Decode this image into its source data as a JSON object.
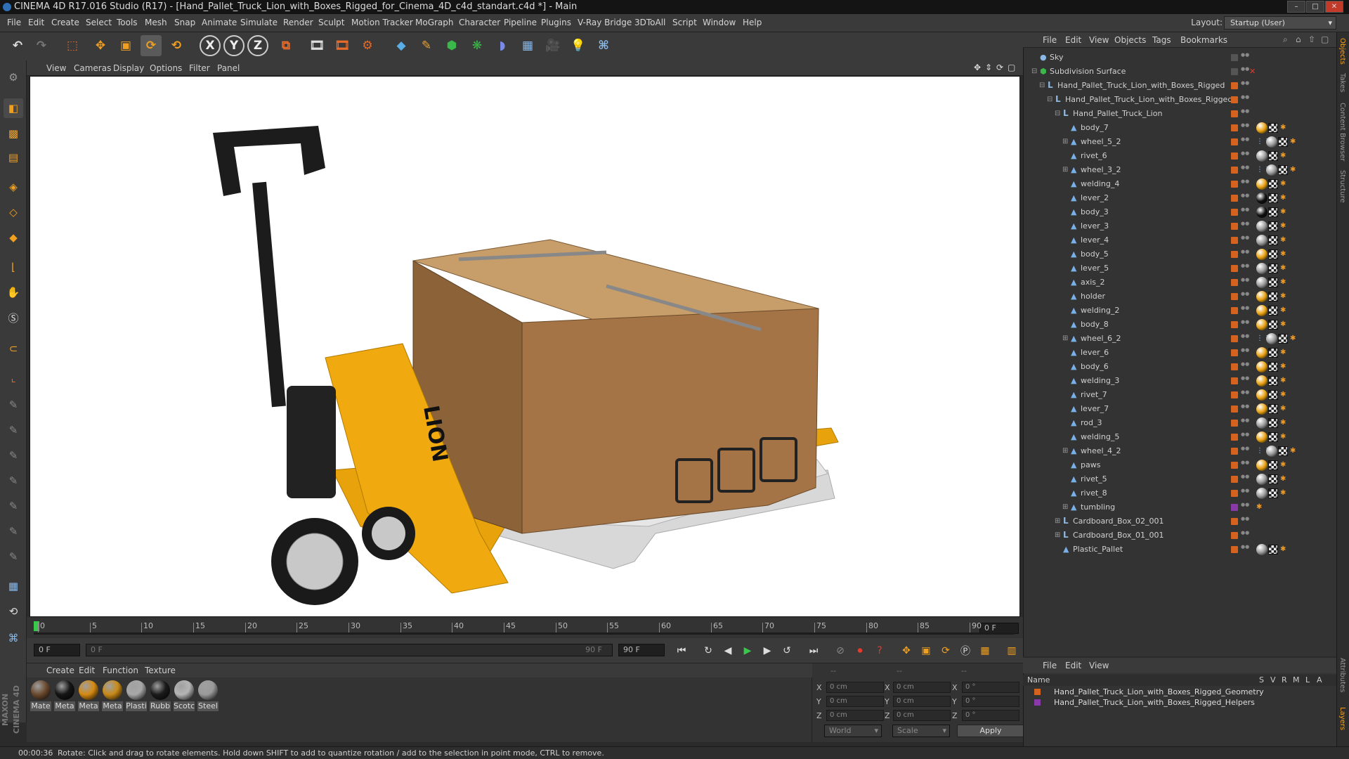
{
  "window": {
    "title": "CINEMA 4D R17.016 Studio (R17) - [Hand_Pallet_Truck_Lion_with_Boxes_Rigged_for_Cinema_4D_c4d_standart.c4d *] - Main"
  },
  "menubar": {
    "items": [
      "File",
      "Edit",
      "Create",
      "Select",
      "Tools",
      "Mesh",
      "Snap",
      "Animate",
      "Simulate",
      "Render",
      "Sculpt",
      "Motion Tracker",
      "MoGraph",
      "Character",
      "Pipeline",
      "Plugins",
      "V-Ray Bridge",
      "3DToAll",
      "Script",
      "Window",
      "Help"
    ],
    "layout_label": "Layout:",
    "layout_value": "Startup (User)"
  },
  "viewport_menu": [
    "View",
    "Cameras",
    "Display",
    "Options",
    "Filter",
    "Panel"
  ],
  "timeline": {
    "ticks": [
      "0",
      "5",
      "10",
      "15",
      "20",
      "25",
      "30",
      "35",
      "40",
      "45",
      "50",
      "55",
      "60",
      "65",
      "70",
      "75",
      "80",
      "85",
      "90"
    ],
    "current_frame_right": "0 F",
    "frame_start": "0 F",
    "frame_field": "0 F",
    "frame_end_inner": "90 F",
    "frame_end": "90 F"
  },
  "material_menu": [
    "Create",
    "Edit",
    "Function",
    "Texture"
  ],
  "materials": [
    {
      "label": "Mate",
      "color": "#6b4a2f"
    },
    {
      "label": "Meta",
      "color": "#151515"
    },
    {
      "label": "Meta",
      "color": "#d58a12"
    },
    {
      "label": "Meta",
      "color": "#c98a18"
    },
    {
      "label": "Plasti",
      "color": "#a8a8a8"
    },
    {
      "label": "Rubb",
      "color": "#1b1b1b"
    },
    {
      "label": "Scotc",
      "color": "#b5b5b5"
    },
    {
      "label": "Steel",
      "color": "#9a9a9a"
    }
  ],
  "coords": {
    "header_dashes": [
      "--",
      "--",
      "--"
    ],
    "rows": [
      {
        "a": "X",
        "av": "0 cm",
        "b": "X",
        "bv": "0 cm",
        "c": "X",
        "cv": "0 °"
      },
      {
        "a": "Y",
        "av": "0 cm",
        "b": "Y",
        "bv": "0 cm",
        "c": "Y",
        "cv": "0 °"
      },
      {
        "a": "Z",
        "av": "0 cm",
        "b": "Z",
        "bv": "0 cm",
        "c": "Z",
        "cv": "0 °"
      }
    ],
    "space": "World",
    "mode": "Scale",
    "apply": "Apply"
  },
  "object_manager": {
    "menu": [
      "File",
      "Edit",
      "View",
      "Objects",
      "Tags",
      "Bookmarks"
    ],
    "objects": [
      {
        "name": "Sky",
        "depth": 0,
        "tree": "",
        "type": "sky",
        "tags": []
      },
      {
        "name": "Subdivision Surface",
        "depth": 0,
        "tree": "⊟",
        "type": "subdiv",
        "tags": []
      },
      {
        "name": "Hand_Pallet_Truck_Lion_with_Boxes_Rigged",
        "depth": 1,
        "tree": "⊟",
        "type": "null",
        "tags": []
      },
      {
        "name": "Hand_Pallet_Truck_Lion_with_Boxes_Rigged",
        "depth": 2,
        "tree": "⊟",
        "type": "null",
        "tags": []
      },
      {
        "name": "Hand_Pallet_Truck_Lion",
        "depth": 3,
        "tree": "⊟",
        "type": "null",
        "tags": []
      },
      {
        "name": "body_7",
        "depth": 4,
        "tree": "",
        "type": "poly",
        "tags": [
          "ball-orange",
          "chk",
          "or"
        ]
      },
      {
        "name": "wheel_5_2",
        "depth": 4,
        "tree": "⊞",
        "type": "poly",
        "tags": [
          "dots",
          "ball-grey",
          "chk",
          "or"
        ]
      },
      {
        "name": "rivet_6",
        "depth": 4,
        "tree": "",
        "type": "poly",
        "tags": [
          "ball-grey",
          "chk",
          "or"
        ]
      },
      {
        "name": "wheel_3_2",
        "depth": 4,
        "tree": "⊞",
        "type": "poly",
        "tags": [
          "dots",
          "ball-grey",
          "chk",
          "or"
        ]
      },
      {
        "name": "welding_4",
        "depth": 4,
        "tree": "",
        "type": "poly",
        "tags": [
          "ball-orange",
          "chk",
          "or"
        ]
      },
      {
        "name": "lever_2",
        "depth": 4,
        "tree": "",
        "type": "poly",
        "tags": [
          "ball-black",
          "chk",
          "or"
        ]
      },
      {
        "name": "body_3",
        "depth": 4,
        "tree": "",
        "type": "poly",
        "tags": [
          "ball-black",
          "chk",
          "or"
        ]
      },
      {
        "name": "lever_3",
        "depth": 4,
        "tree": "",
        "type": "poly",
        "tags": [
          "ball-grey",
          "chk",
          "or"
        ]
      },
      {
        "name": "lever_4",
        "depth": 4,
        "tree": "",
        "type": "poly",
        "tags": [
          "ball-grey",
          "chk",
          "or"
        ]
      },
      {
        "name": "body_5",
        "depth": 4,
        "tree": "",
        "type": "poly",
        "tags": [
          "ball-orange",
          "chk",
          "or"
        ]
      },
      {
        "name": "lever_5",
        "depth": 4,
        "tree": "",
        "type": "poly",
        "tags": [
          "ball-grey",
          "chk",
          "or"
        ]
      },
      {
        "name": "axis_2",
        "depth": 4,
        "tree": "",
        "type": "poly",
        "tags": [
          "ball-grey",
          "chk",
          "or"
        ]
      },
      {
        "name": "holder",
        "depth": 4,
        "tree": "",
        "type": "poly",
        "tags": [
          "ball-orange",
          "chk",
          "or"
        ]
      },
      {
        "name": "welding_2",
        "depth": 4,
        "tree": "",
        "type": "poly",
        "tags": [
          "ball-orange",
          "chk",
          "or"
        ]
      },
      {
        "name": "body_8",
        "depth": 4,
        "tree": "",
        "type": "poly",
        "tags": [
          "ball-orange",
          "chk",
          "or"
        ]
      },
      {
        "name": "wheel_6_2",
        "depth": 4,
        "tree": "⊞",
        "type": "poly",
        "tags": [
          "dots",
          "ball-grey",
          "chk",
          "or"
        ]
      },
      {
        "name": "lever_6",
        "depth": 4,
        "tree": "",
        "type": "poly",
        "tags": [
          "ball-orange",
          "chk",
          "or"
        ]
      },
      {
        "name": "body_6",
        "depth": 4,
        "tree": "",
        "type": "poly",
        "tags": [
          "ball-orange",
          "chk",
          "or"
        ]
      },
      {
        "name": "welding_3",
        "depth": 4,
        "tree": "",
        "type": "poly",
        "tags": [
          "ball-orange",
          "chk",
          "or"
        ]
      },
      {
        "name": "rivet_7",
        "depth": 4,
        "tree": "",
        "type": "poly",
        "tags": [
          "ball-orange",
          "chk",
          "or"
        ]
      },
      {
        "name": "lever_7",
        "depth": 4,
        "tree": "",
        "type": "poly",
        "tags": [
          "ball-orange",
          "chk",
          "or"
        ]
      },
      {
        "name": "rod_3",
        "depth": 4,
        "tree": "",
        "type": "poly",
        "tags": [
          "ball-grey",
          "chk",
          "or"
        ]
      },
      {
        "name": "welding_5",
        "depth": 4,
        "tree": "",
        "type": "poly",
        "tags": [
          "ball-orange",
          "chk",
          "or"
        ]
      },
      {
        "name": "wheel_4_2",
        "depth": 4,
        "tree": "⊞",
        "type": "poly",
        "tags": [
          "dots",
          "ball-grey",
          "chk",
          "or"
        ]
      },
      {
        "name": "paws",
        "depth": 4,
        "tree": "",
        "type": "poly",
        "tags": [
          "ball-orange",
          "chk",
          "or"
        ]
      },
      {
        "name": "rivet_5",
        "depth": 4,
        "tree": "",
        "type": "poly",
        "tags": [
          "ball-grey",
          "chk",
          "or"
        ]
      },
      {
        "name": "rivet_8",
        "depth": 4,
        "tree": "",
        "type": "poly",
        "tags": [
          "ball-grey",
          "chk",
          "or"
        ]
      },
      {
        "name": "tumbling",
        "depth": 4,
        "tree": "⊞",
        "type": "poly",
        "tags": [
          "or"
        ]
      },
      {
        "name": "Cardboard_Box_02_001",
        "depth": 3,
        "tree": "⊞",
        "type": "null",
        "tags": []
      },
      {
        "name": "Cardboard_Box_01_001",
        "depth": 3,
        "tree": "⊞",
        "type": "null",
        "tags": []
      },
      {
        "name": "Plastic_Pallet",
        "depth": 3,
        "tree": "",
        "type": "poly",
        "tags": [
          "ball-grey",
          "chk",
          "or"
        ]
      }
    ]
  },
  "layer_manager": {
    "menu": [
      "File",
      "Edit",
      "View"
    ],
    "columns": [
      "Name",
      "S",
      "V",
      "R",
      "M",
      "L",
      "A"
    ],
    "layers": [
      {
        "name": "Hand_Pallet_Truck_Lion_with_Boxes_Rigged_Geometry",
        "color": "#d4631d"
      },
      {
        "name": "Hand_Pallet_Truck_Lion_with_Boxes_Rigged_Helpers",
        "color": "#8a3aa8"
      }
    ]
  },
  "right_tabs": [
    "Objects",
    "Takes",
    "Content Browser",
    "Structure",
    "Attributes",
    "Layers"
  ],
  "status": {
    "time": "00:00:36",
    "message": "Rotate: Click and drag to rotate elements. Hold down SHIFT to add to quantize rotation / add to the selection in point mode, CTRL to remove."
  },
  "colors": {
    "accent_orange": "#d4631d",
    "ui_bg": "#333333",
    "viewport_bg": "#ffffff"
  }
}
